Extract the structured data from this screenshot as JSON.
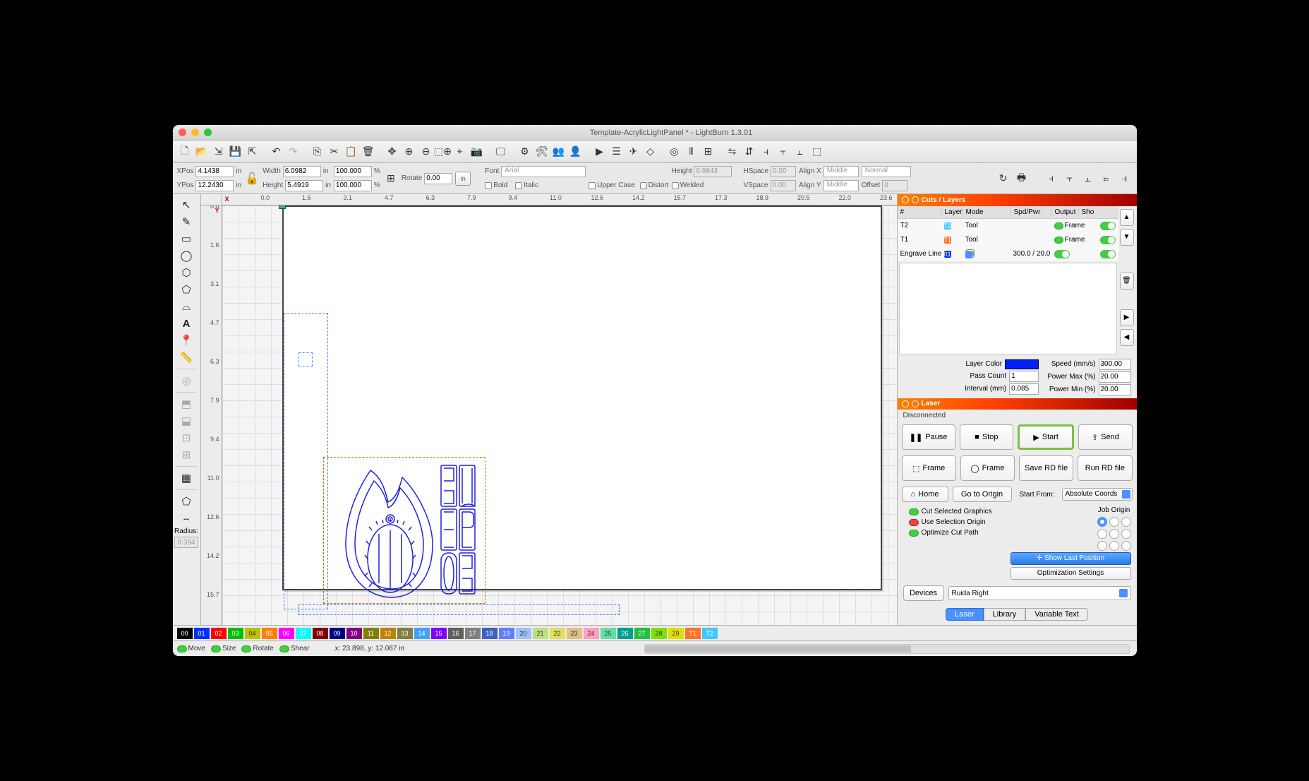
{
  "title": "Template-AcrylicLightPanel * - LightBurn 1.3.01",
  "properties": {
    "xpos_label": "XPos",
    "xpos": "4.1438",
    "ypos_label": "YPos",
    "ypos": "12.2430",
    "width_label": "Width",
    "width": "6.0982",
    "height_label": "Height",
    "height": "5.4919",
    "width_pct": "100.000",
    "height_pct": "100.000",
    "rotate_label": "Rotate",
    "rotate": "0.00",
    "unit_in": "in",
    "unit_pct": "%",
    "font_label": "Font",
    "font": "Arial",
    "font_height_label": "Height",
    "font_height": "0.9843",
    "bold": "Bold",
    "italic": "Italic",
    "upper": "Upper Case",
    "distort": "Distort",
    "welded": "Welded",
    "hspace_label": "HSpace",
    "hspace": "0.00",
    "vspace_label": "VSpace",
    "vspace": "0.00",
    "alignx_label": "Align X",
    "alignx": "Middle",
    "normal": "Normal",
    "aligny_label": "Align Y",
    "aligny": "Middle",
    "offset_label": "Offset",
    "offset": "0"
  },
  "radius_label": "Radius:",
  "radius": "0.394",
  "ruler_h": [
    "0.0",
    "1.6",
    "3.1",
    "4.7",
    "6.3",
    "7.9",
    "9.4",
    "11.0",
    "12.6",
    "14.2",
    "15.7",
    "17.3",
    "18.9",
    "20.5",
    "22.0",
    "23.6"
  ],
  "ruler_v": [
    "0.0",
    "1.6",
    "3.1",
    "4.7",
    "6.3",
    "7.9",
    "9.4",
    "11.0",
    "12.6",
    "14.2",
    "15.7"
  ],
  "ruler_v_right": [
    "0.0",
    "1.6",
    "3.1",
    "4.7",
    "6.3",
    "7.9",
    "9.4",
    "11.0",
    "12.6",
    "14.2",
    "15.7"
  ],
  "cuts_panel": {
    "title": "Cuts / Layers",
    "columns": {
      "num": "#",
      "layer": "Layer",
      "mode": "Mode",
      "spdpwr": "Spd/Pwr",
      "output": "Output",
      "show": "Sho"
    },
    "rows": [
      {
        "name": "T2",
        "swatch": "T2",
        "swatch_color": "#40c8ff",
        "mode": "Tool",
        "spdpwr": "",
        "extra": "Frame"
      },
      {
        "name": "T1",
        "swatch": "T1",
        "swatch_color": "#ff7028",
        "mode": "Tool",
        "spdpwr": "",
        "extra": "Frame"
      },
      {
        "name": "Engrave Line",
        "swatch": "01",
        "swatch_color": "#0030ff",
        "mode": "Fill",
        "spdpwr": "300.0 / 20.0",
        "extra": ""
      }
    ],
    "props": {
      "layer_color": "Layer Color",
      "pass_count": "Pass Count",
      "pass_count_v": "1",
      "interval": "Interval (mm)",
      "interval_v": "0.085",
      "speed": "Speed (mm/s)",
      "speed_v": "300.00",
      "power_max": "Power Max (%)",
      "power_max_v": "20.00",
      "power_min": "Power Min (%)",
      "power_min_v": "20.00"
    }
  },
  "laser_panel": {
    "title": "Laser",
    "status": "Disconnected",
    "pause": "Pause",
    "stop": "Stop",
    "start": "Start",
    "send": "Send",
    "frame1": "Frame",
    "frame2": "Frame",
    "save_rd": "Save RD file",
    "run_rd": "Run RD file",
    "home": "Home",
    "go_origin": "Go to Origin",
    "start_from": "Start From:",
    "start_from_v": "Absolute Coords",
    "job_origin": "Job Origin",
    "cut_sel": "Cut Selected Graphics",
    "use_sel": "Use Selection Origin",
    "opt_path": "Optimize Cut Path",
    "show_last": "Show Last Position",
    "opt_settings": "Optimization Settings",
    "devices": "Devices",
    "device": "Ruida Right"
  },
  "tabs": {
    "laser": "Laser",
    "library": "Library",
    "vartext": "Variable Text"
  },
  "palette": [
    {
      "n": "00",
      "c": "#000000"
    },
    {
      "n": "01",
      "c": "#0030ff"
    },
    {
      "n": "02",
      "c": "#ff0000"
    },
    {
      "n": "03",
      "c": "#00c000"
    },
    {
      "n": "04",
      "c": "#c0c000"
    },
    {
      "n": "05",
      "c": "#ff8000"
    },
    {
      "n": "06",
      "c": "#ff00ff"
    },
    {
      "n": "07",
      "c": "#00ffff"
    },
    {
      "n": "08",
      "c": "#800000"
    },
    {
      "n": "09",
      "c": "#000080"
    },
    {
      "n": "10",
      "c": "#800080"
    },
    {
      "n": "11",
      "c": "#808000"
    },
    {
      "n": "12",
      "c": "#c08000"
    },
    {
      "n": "13",
      "c": "#808040"
    },
    {
      "n": "14",
      "c": "#40a0ff"
    },
    {
      "n": "15",
      "c": "#8000ff"
    },
    {
      "n": "16",
      "c": "#606060"
    },
    {
      "n": "17",
      "c": "#808080"
    },
    {
      "n": "18",
      "c": "#4060c0"
    },
    {
      "n": "19",
      "c": "#6080ff"
    },
    {
      "n": "20",
      "c": "#a0c0ff"
    },
    {
      "n": "21",
      "c": "#c0e080"
    },
    {
      "n": "22",
      "c": "#e0e060"
    },
    {
      "n": "23",
      "c": "#e0c080"
    },
    {
      "n": "24",
      "c": "#ffa0c0"
    },
    {
      "n": "25",
      "c": "#60e0a0"
    },
    {
      "n": "26",
      "c": "#00a090"
    },
    {
      "n": "27",
      "c": "#20c040"
    },
    {
      "n": "28",
      "c": "#80e000"
    },
    {
      "n": "29",
      "c": "#e0e000"
    },
    {
      "n": "T1",
      "c": "#ff7028"
    },
    {
      "n": "T2",
      "c": "#40c8ff"
    }
  ],
  "statusbar": {
    "move": "Move",
    "size": "Size",
    "rotate": "Rotate",
    "shear": "Shear",
    "coords": "x: 23.898, y: 12.087 in"
  }
}
